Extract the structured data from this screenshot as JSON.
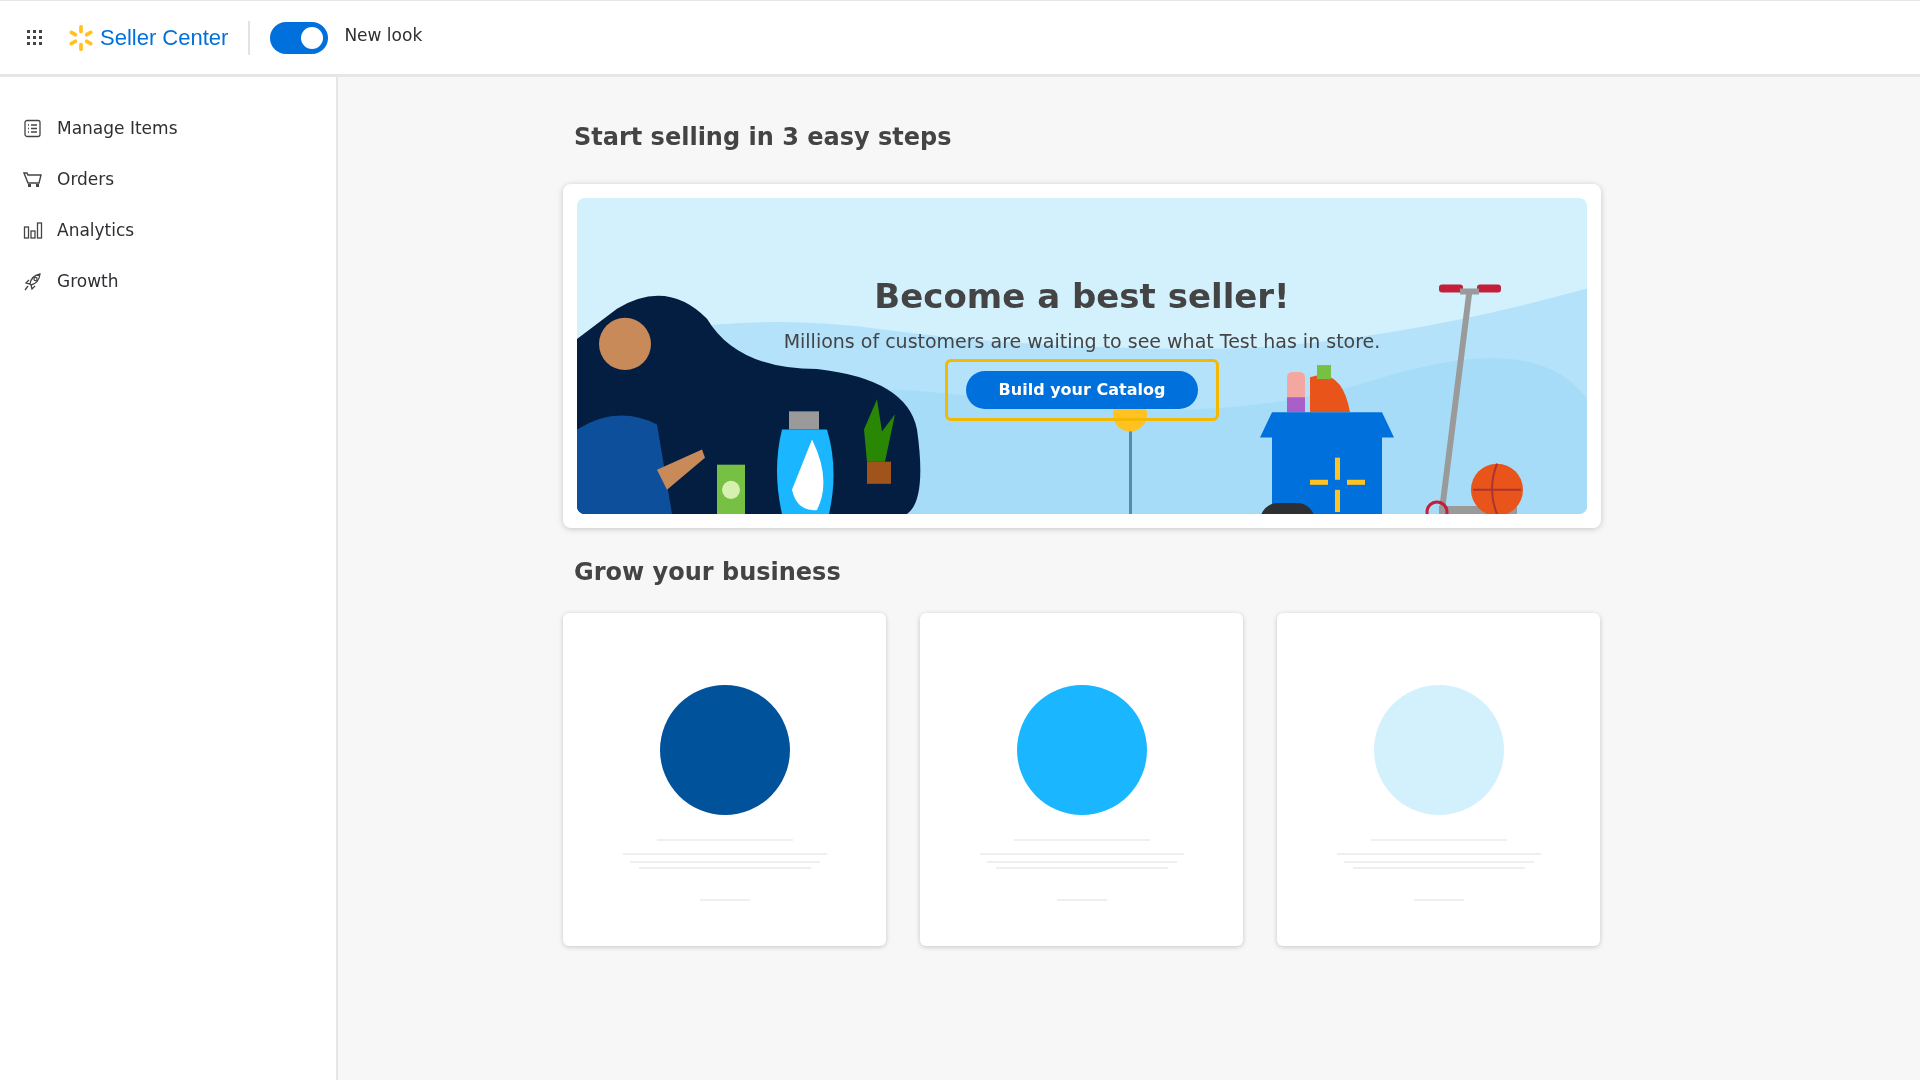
{
  "header": {
    "brand": "Seller Center",
    "toggle": {
      "label": "New look",
      "on": true
    }
  },
  "sidebar": {
    "items": [
      {
        "label": "Manage Items"
      },
      {
        "label": "Orders"
      },
      {
        "label": "Analytics"
      },
      {
        "label": "Growth"
      }
    ]
  },
  "main": {
    "steps_title": "Start selling in 3 easy steps",
    "banner": {
      "title": "Become a best seller!",
      "subtitle": "Millions of customers are waiting to see what Test has in store.",
      "button": {
        "label": "Build your Catalog",
        "focused": true
      }
    },
    "grow_title": "Grow your business",
    "cards": [
      {
        "color": "#00529b"
      },
      {
        "color": "#1ab6ff"
      },
      {
        "color": "#d2f1fd"
      }
    ]
  }
}
